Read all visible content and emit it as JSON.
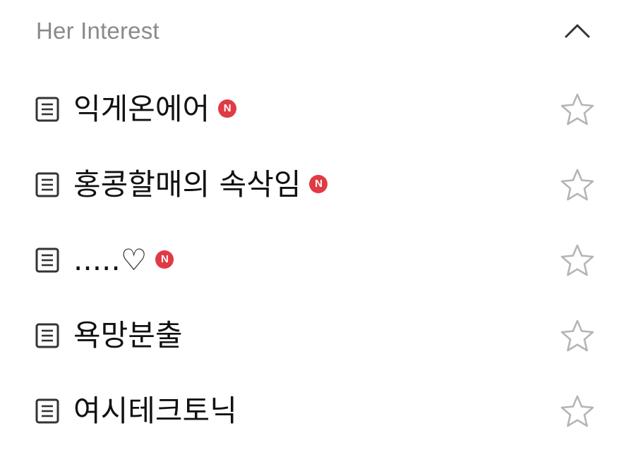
{
  "section": {
    "title": "Her Interest",
    "toggle_icon": "chevron-up-icon"
  },
  "boards": [
    {
      "label": "익게온에어",
      "badge": "N",
      "favorite": false
    },
    {
      "label": "홍콩할매의 속삭임",
      "badge": "N",
      "favorite": false
    },
    {
      "label": ".....♡",
      "badge": "N",
      "favorite": false
    },
    {
      "label": "욕망분출",
      "badge": "",
      "favorite": false
    },
    {
      "label": "여시테크토닉",
      "badge": "",
      "favorite": false
    }
  ],
  "colors": {
    "badge": "#e03b45",
    "title": "#8a8a8a",
    "star_outline": "#b5b5b5",
    "icon": "#333333"
  }
}
